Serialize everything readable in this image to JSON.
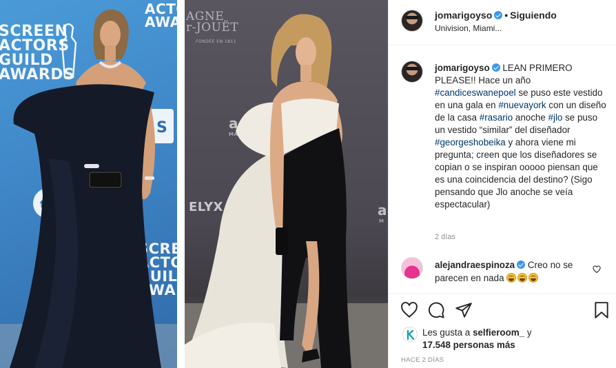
{
  "post": {
    "photo": {
      "left_backdrop_text": "SCREEN\nACTORS\nGUILD\nAWARDS",
      "left_backdrop_text_2": "SCREEN\nACTORS\nGUILD\nAWARDS",
      "left_top_text": "ACTO\nAWA",
      "left_sign_tnt": "tnt",
      "left_sign_s": "S",
      "right_brand_top": "AGNE\nr-JOUËT",
      "right_brand_small": "FONDÉE EN 1811",
      "right_brand_elyx": "ELYX",
      "right_brand_a": "a",
      "right_brand_ma": "MA",
      "right_brand_a2": "a",
      "right_brand_m": "M"
    },
    "header": {
      "username": "jomarigoyso",
      "separator": "•",
      "follow_status": "Siguiendo",
      "location": "Univision, Miami..."
    },
    "caption": {
      "username": "jomarigoyso",
      "parts": [
        {
          "text": " LEAN PRIMERO PLEASE!! Hace un año ",
          "tag": false
        },
        {
          "text": "#candiceswanepoel",
          "tag": true
        },
        {
          "text": " se puso este vestido en una gala en ",
          "tag": false
        },
        {
          "text": "#nuevayork",
          "tag": true
        },
        {
          "text": " con un diseño de la casa ",
          "tag": false
        },
        {
          "text": "#rasario",
          "tag": true
        },
        {
          "text": " anoche ",
          "tag": false
        },
        {
          "text": "#jlo",
          "tag": true
        },
        {
          "text": " se puso un vestido “similar” del diseñador ",
          "tag": false
        },
        {
          "text": "#georgeshobeika",
          "tag": true
        },
        {
          "text": " y ahora viene mi pregunta; creen que los diseñadores se copian o se inspiran ooooo piensan que es una coincidencia del destino? (Sigo pensando que Jlo anoche se veía espectacular)",
          "tag": false
        }
      ],
      "time": "2 días"
    },
    "comment": {
      "username": "alejandraespinoza",
      "text": " Creo no se parecen en nada "
    },
    "actions": {
      "icons": [
        "heart-icon",
        "comment-icon",
        "share-icon",
        "bookmark-icon"
      ]
    },
    "likes": {
      "prefix": "Les gusta a ",
      "user": "selfieroom_",
      "middle": " y",
      "count": "17.548 personas más"
    },
    "timestamp": "HACE 2 DÍAS",
    "colors": {
      "link": "#00376b",
      "verified": "#3897f0",
      "muted": "#8e8e8e",
      "border": "#efefef"
    }
  }
}
